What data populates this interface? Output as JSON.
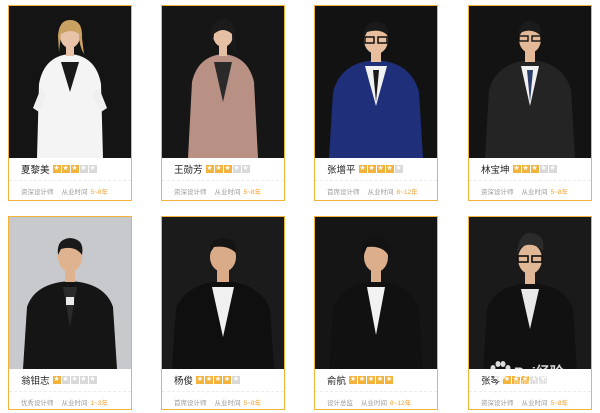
{
  "designers": [
    {
      "name": "夏黎美",
      "rating": 3,
      "title": "资深设计师",
      "exp_label": "从业时间",
      "exp": "5~8年"
    },
    {
      "name": "王勋芳",
      "rating": 3,
      "title": "资深设计师",
      "exp_label": "从业时间",
      "exp": "5~8年"
    },
    {
      "name": "张增平",
      "rating": 4,
      "title": "首席设计师",
      "exp_label": "从业时间",
      "exp": "8~12年"
    },
    {
      "name": "林宝坤",
      "rating": 3,
      "title": "资深设计师",
      "exp_label": "从业时间",
      "exp": "5~8年"
    },
    {
      "name": "翁钼志",
      "rating": 1,
      "title": "优秀设计师",
      "exp_label": "从业时间",
      "exp": "1~3年"
    },
    {
      "name": "杨俊",
      "rating": 4,
      "title": "首席设计师",
      "exp_label": "从业时间",
      "exp": "5~8年"
    },
    {
      "name": "俞航",
      "rating": 5,
      "title": "设计总监",
      "exp_label": "从业时间",
      "exp": "8~12年"
    },
    {
      "name": "张琴",
      "rating": 3,
      "title": "资深设计师",
      "exp_label": "从业时间",
      "exp": "5~8年"
    }
  ],
  "watermark": {
    "main": "Bai经验",
    "sub": "jingyan.baidu.com"
  },
  "colors": {
    "accent": "#f2b33d",
    "exp_value": "#f2a030"
  }
}
